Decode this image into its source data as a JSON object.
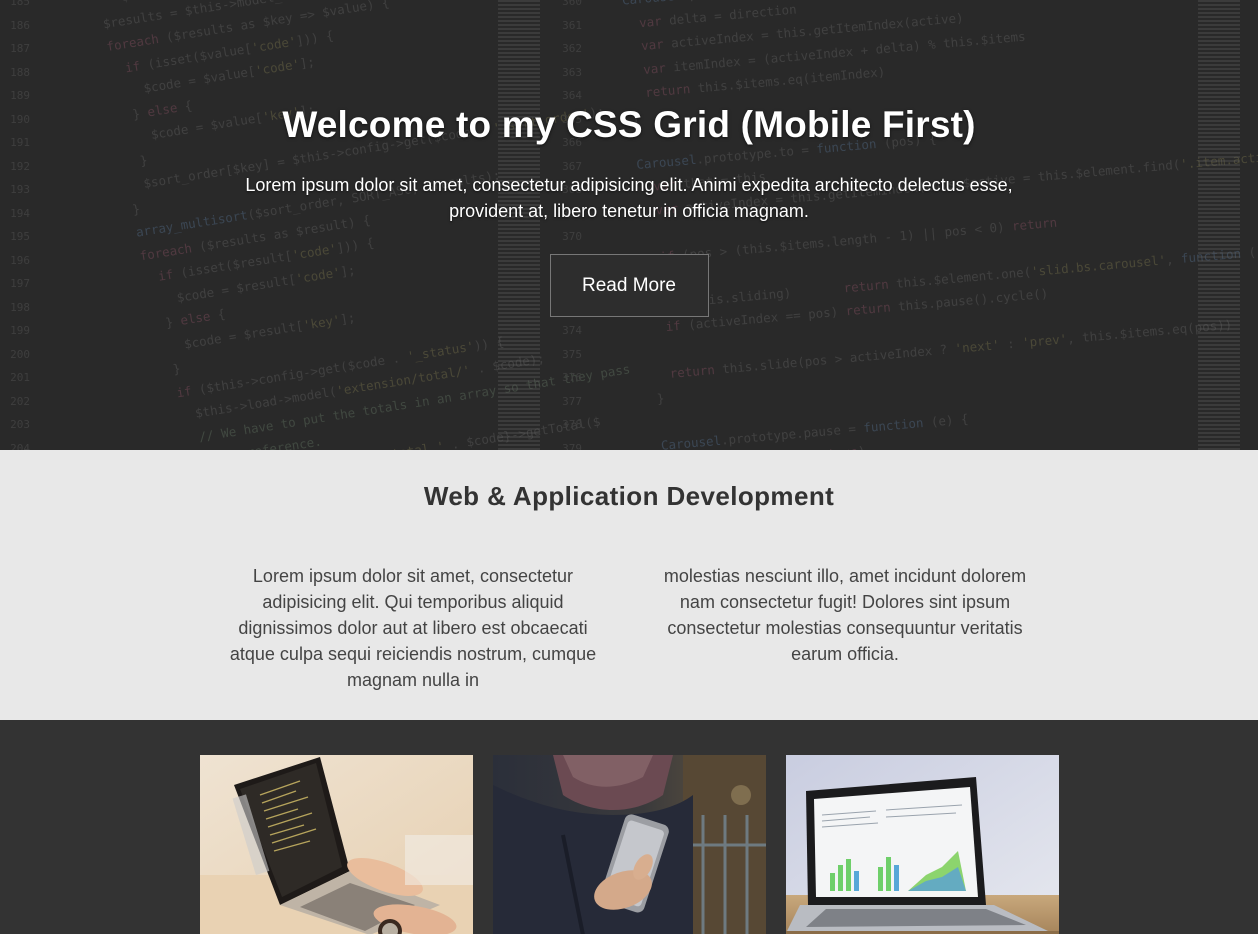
{
  "hero": {
    "title": "Welcome to my CSS Grid (Mobile First)",
    "text": "Lorem ipsum dolor sit amet, consectetur adipisicing elit. Animi expedita architecto delectus esse, provident at, libero tenetur in officia magnam.",
    "button_label": "Read More",
    "background": "code-editor-photo"
  },
  "services": {
    "title": "Web & Application Development",
    "col1": "Lorem ipsum dolor sit amet, consectetur adipisicing elit. Qui temporibus aliquid dignissimos dolor aut at libero est obcaecati atque culpa sequi reiciendis nostrum, cumque magnam nulla in",
    "col2": "molestias nesciunt illo, amet incidunt dolorem nam consectetur fugit! Dolores sint ipsum consectetur molestias consequuntur veritatis earum officia."
  },
  "gallery": {
    "images": [
      {
        "name": "laptop-coding-photo"
      },
      {
        "name": "phone-in-hand-photo"
      },
      {
        "name": "laptop-charts-photo"
      }
    ]
  },
  "colors": {
    "hero_bg": "#2a2a2a",
    "services_bg": "#e8e8e8",
    "gallery_bg": "#333333",
    "text_dark": "#333333"
  }
}
